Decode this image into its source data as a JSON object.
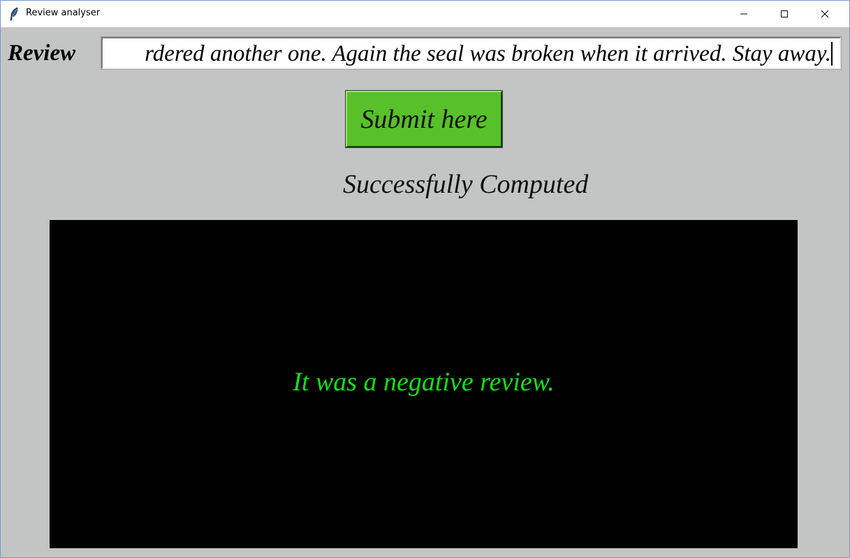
{
  "window": {
    "title": "Review analyser",
    "controls": {
      "minimize": "minimize",
      "maximize": "maximize",
      "close": "close"
    }
  },
  "form": {
    "review_label": "Review",
    "review_value": "rdered another one. Again the seal was broken when it arrived. Stay away.",
    "submit_label": "Submit here"
  },
  "status": {
    "text": "Successfully Computed"
  },
  "result": {
    "text": "It was a negative review."
  },
  "colors": {
    "background": "#c3c5c4",
    "submit_button": "#58c12a",
    "result_panel": "#000000",
    "result_text": "#14e014"
  },
  "icons": {
    "app": "feather-icon",
    "minimize": "minimize-icon",
    "maximize": "maximize-icon",
    "close": "close-icon"
  }
}
